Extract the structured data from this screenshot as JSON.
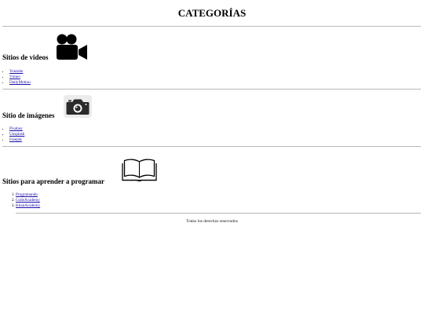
{
  "header": {
    "title": "CATEGORÍAS"
  },
  "sections": [
    {
      "heading": "Sitios de videos",
      "icon": "video-camera-icon",
      "links": [
        "Youtube",
        "Vimeo",
        "DailyMotion"
      ]
    },
    {
      "heading": "Sitio de imágenes",
      "icon": "camera-icon",
      "links": [
        "Pixabay",
        "Unsplash",
        "Freepik"
      ]
    },
    {
      "heading": "Sitios para aprender a programar",
      "icon": "open-book-icon",
      "links": [
        "Programando",
        "CodeAcademy",
        "KhanAcademy"
      ]
    }
  ],
  "footer": {
    "text": "Todos los derechos reservados"
  },
  "colors": {
    "link": "#1a0dab",
    "divider": "#b8b8b8"
  }
}
